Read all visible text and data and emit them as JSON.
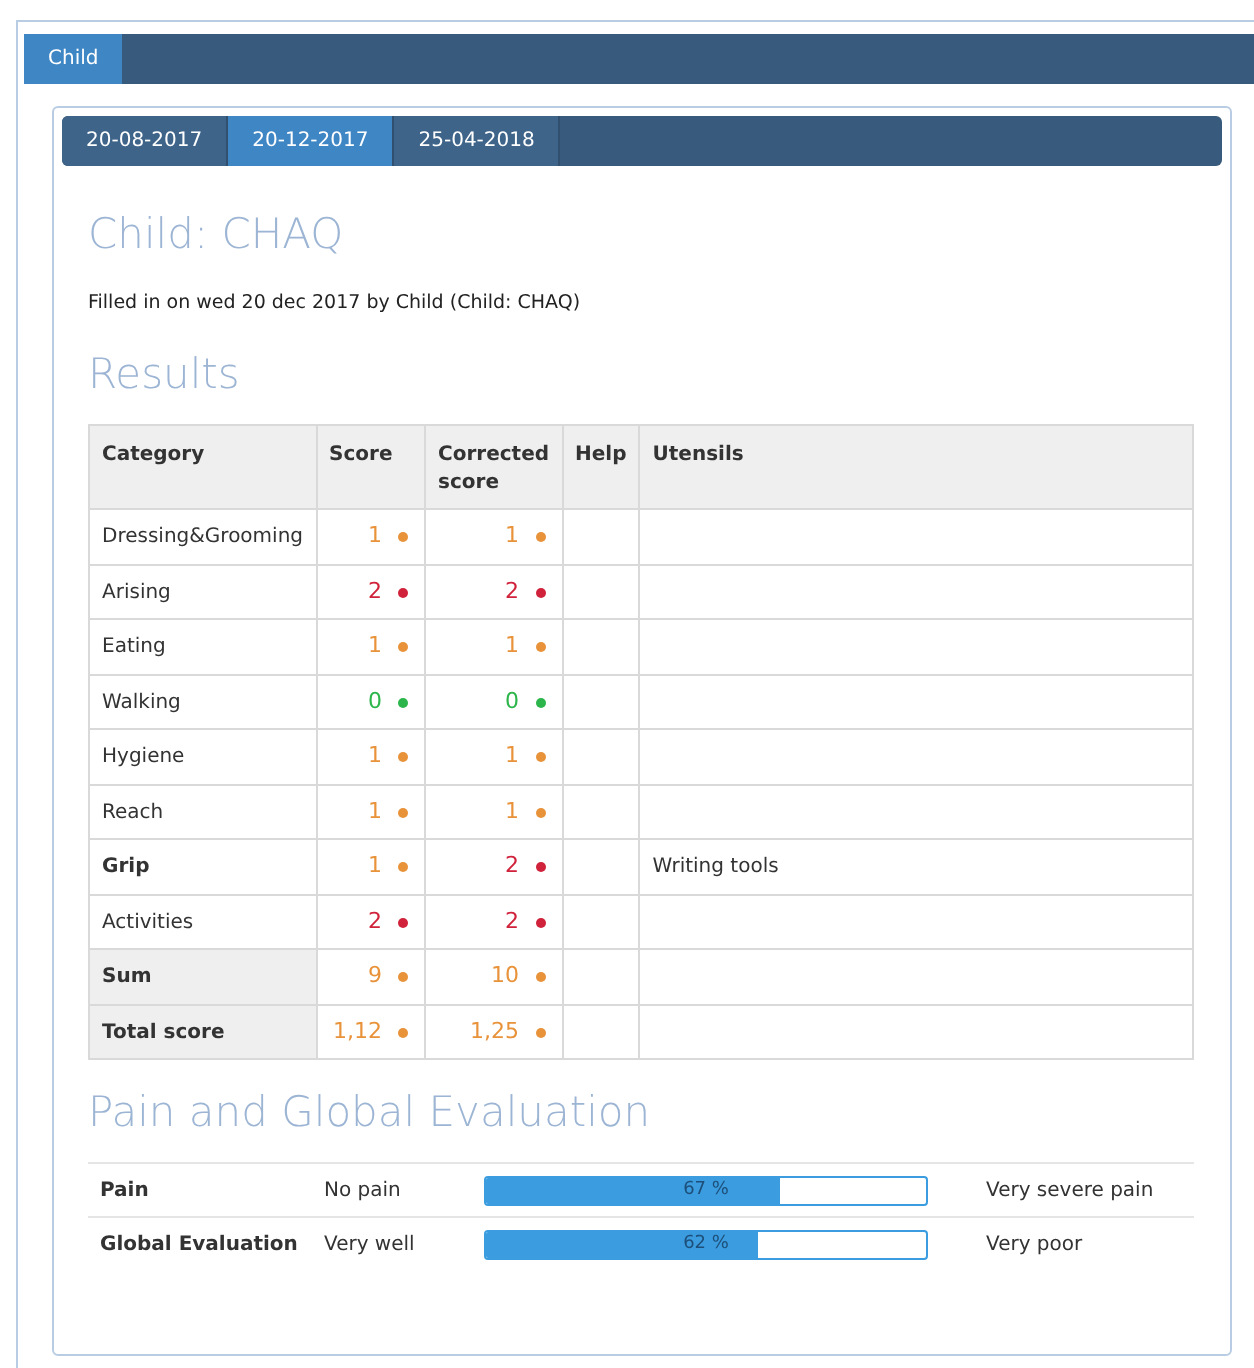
{
  "outer_tabs": [
    {
      "label": "Child",
      "selected": true
    }
  ],
  "date_tabs": [
    {
      "label": "20-08-2017",
      "selected": false
    },
    {
      "label": "20-12-2017",
      "selected": true
    },
    {
      "label": "25-04-2018",
      "selected": false
    }
  ],
  "title": "Child: CHAQ",
  "subtitle": "Filled in on wed 20 dec 2017 by Child (Child: CHAQ)",
  "results_heading": "Results",
  "table": {
    "columns": [
      "Category",
      "Score",
      "Corrected score",
      "Help",
      "Utensils"
    ],
    "rows": [
      {
        "kind": "item",
        "emphasized": false,
        "category": "Dressing&Grooming",
        "score": {
          "value": "1",
          "color": "#e8923a"
        },
        "corrected": {
          "value": "1",
          "color": "#e8923a"
        }
      },
      {
        "kind": "item",
        "emphasized": false,
        "category": "Arising",
        "score": {
          "value": "2",
          "color": "#d0223a"
        },
        "corrected": {
          "value": "2",
          "color": "#d0223a"
        }
      },
      {
        "kind": "item",
        "emphasized": false,
        "category": "Eating",
        "score": {
          "value": "1",
          "color": "#e8923a"
        },
        "corrected": {
          "value": "1",
          "color": "#e8923a"
        }
      },
      {
        "kind": "item",
        "emphasized": false,
        "category": "Walking",
        "score": {
          "value": "0",
          "color": "#2bb54a"
        },
        "corrected": {
          "value": "0",
          "color": "#2bb54a"
        }
      },
      {
        "kind": "item",
        "emphasized": false,
        "category": "Hygiene",
        "score": {
          "value": "1",
          "color": "#e8923a"
        },
        "corrected": {
          "value": "1",
          "color": "#e8923a"
        }
      },
      {
        "kind": "item",
        "emphasized": false,
        "category": "Reach",
        "score": {
          "value": "1",
          "color": "#e8923a"
        },
        "corrected": {
          "value": "1",
          "color": "#e8923a"
        }
      },
      {
        "kind": "item",
        "emphasized": true,
        "category": "Grip",
        "score": {
          "value": "1",
          "color": "#e8923a"
        },
        "corrected": {
          "value": "2",
          "color": "#d0223a"
        },
        "utensils": "Writing tools"
      },
      {
        "kind": "item",
        "emphasized": false,
        "category": "Activities",
        "score": {
          "value": "2",
          "color": "#d0223a"
        },
        "corrected": {
          "value": "2",
          "color": "#d0223a"
        }
      },
      {
        "kind": "summary",
        "emphasized": true,
        "category": "Sum",
        "score": {
          "value": "9",
          "color": "#e8923a"
        },
        "corrected": {
          "value": "10",
          "color": "#e8923a"
        }
      },
      {
        "kind": "summary",
        "emphasized": true,
        "category": "Total score",
        "score": {
          "value": "1,12",
          "color": "#e8923a"
        },
        "corrected": {
          "value": "1,25",
          "color": "#e8923a"
        }
      }
    ]
  },
  "evaluation_heading": "Pain and Global Evaluation",
  "evaluations": [
    {
      "label": "Pain",
      "low": "No pain",
      "level": 0.67,
      "reading": "67 %",
      "high": "Very severe pain"
    },
    {
      "label": "Global Evaluation",
      "low": "Very well",
      "level": 0.62,
      "reading": "62 %",
      "high": "Very poor"
    }
  ]
}
